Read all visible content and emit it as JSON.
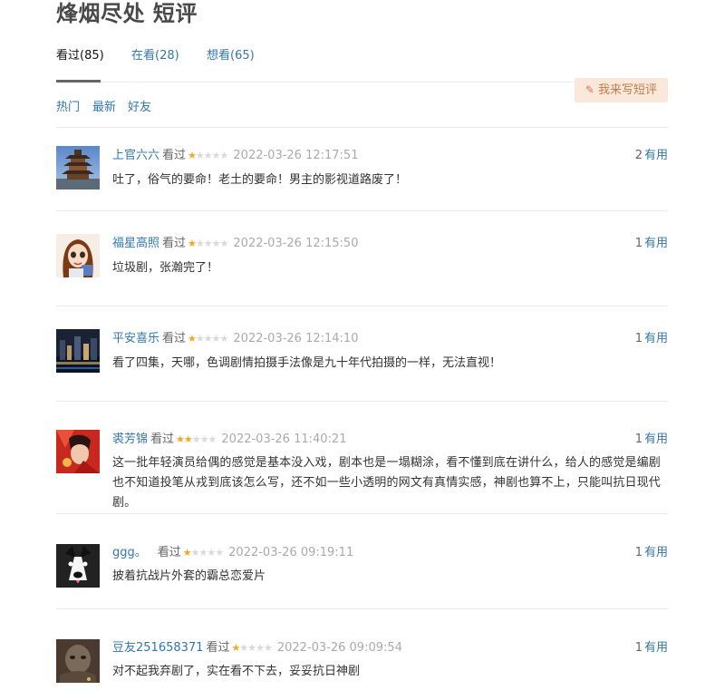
{
  "page": {
    "title": "烽烟尽处 短评"
  },
  "tabs": [
    {
      "label": "看过(85)"
    },
    {
      "label": "在看(28)"
    },
    {
      "label": "想看(65)"
    }
  ],
  "write_button": {
    "label": "我来写短评",
    "icon": "pencil-icon"
  },
  "sort": [
    {
      "label": "热门"
    },
    {
      "label": "最新"
    },
    {
      "label": "好友"
    }
  ],
  "comments": [
    {
      "user": "上官六六",
      "status": "看过",
      "rating": 1,
      "time": "2022-03-26 12:17:51",
      "votes": "2",
      "useful": "有用",
      "text": "吐了，俗气的要命！老土的要命！男主的影视道路废了！"
    },
    {
      "user": "福星高照",
      "status": "看过",
      "rating": 1,
      "time": "2022-03-26 12:15:50",
      "votes": "1",
      "useful": "有用",
      "text": "垃圾剧，张瀚完了！"
    },
    {
      "user": "平安喜乐",
      "status": "看过",
      "rating": 1,
      "time": "2022-03-26 12:14:10",
      "votes": "1",
      "useful": "有用",
      "text": "看了四集，天哪，色调剧情拍摄手法像是九十年代拍摄的一样，无法直视！"
    },
    {
      "user": "裘芳锦",
      "status": "看过",
      "rating": 2,
      "time": "2022-03-26 11:40:21",
      "votes": "1",
      "useful": "有用",
      "text": "这一批年轻演员给偶的感觉是基本没入戏，剧本也是一塌糊涂，看不懂到底在讲什么，给人的感觉是编剧也不知道投笔从戎到底该怎么写，还不如一些小透明的网文有真情实感，神剧也算不上，只能叫抗日现代剧。"
    },
    {
      "user": "ggg。",
      "status": "看过",
      "rating": 1,
      "time": "2022-03-26 09:19:11",
      "votes": "1",
      "useful": "有用",
      "text": "披着抗战片外套的霸总恋爱片"
    },
    {
      "user": "豆友251658371",
      "status": "看过",
      "rating": 1,
      "time": "2022-03-26 09:09:54",
      "votes": "1",
      "useful": "有用",
      "text": "对不起我弃剧了，实在看不下去，妥妥抗日神剧"
    }
  ],
  "colors": {
    "link": "#3377aa",
    "star": "#f5a623",
    "button_bg": "#fae9da"
  }
}
